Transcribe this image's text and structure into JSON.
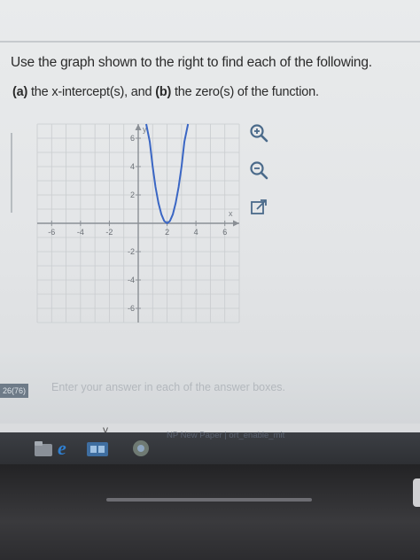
{
  "instruction": "Use the graph shown to the right to find each of the following.",
  "question": {
    "part_a_marker": "(a)",
    "part_a_text": " the x-intercept(s), and ",
    "part_b_marker": "(b)",
    "part_b_text": " the zero(s) of the function."
  },
  "chart_data": {
    "type": "line",
    "xlabel": "x",
    "ylabel": "y",
    "xlim": [
      -7,
      7
    ],
    "ylim": [
      -7,
      7
    ],
    "grid": true,
    "x_ticks": [
      -6,
      -4,
      -2,
      2,
      4,
      6
    ],
    "y_ticks": [
      6,
      4,
      2,
      -2,
      -4,
      -6
    ],
    "x_tick_labels": [
      "-6",
      "-4",
      "-2",
      "2",
      "4",
      "6"
    ],
    "y_tick_labels": [
      "6",
      "4",
      "2",
      "-2",
      "-4",
      "-6"
    ],
    "series": [
      {
        "color": "#3a66c4",
        "x": [
          0.55,
          0.8,
          1.0,
          1.2,
          1.4,
          1.6,
          1.8,
          2.0,
          2.2,
          2.4,
          2.6,
          2.8,
          3.0,
          3.2,
          3.45
        ],
        "y": [
          7.0,
          5.76,
          4.0,
          2.56,
          1.44,
          0.64,
          0.16,
          0.0,
          0.16,
          0.64,
          1.44,
          2.56,
          4.0,
          5.76,
          7.0
        ]
      }
    ]
  },
  "tools": {
    "zoom_in": "zoom-in-icon",
    "zoom_out": "zoom-out-icon",
    "popout": "popout-icon"
  },
  "hint": "Enter your answer in each of the answer boxes.",
  "side_number": "26(76)",
  "status_text": "NP New Paper | ort_enable_mit",
  "cursor_mark": "y",
  "colors": {
    "curve": "#3a66c4",
    "icon": "#4a6a8a",
    "grid": "#c9cccf",
    "axis": "#8a8f95"
  }
}
